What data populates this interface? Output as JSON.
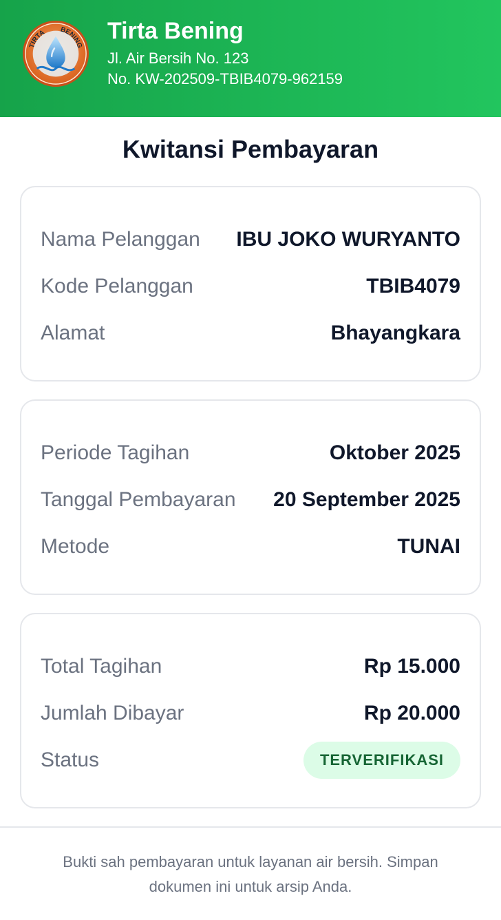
{
  "header": {
    "brand_name": "Tirta Bening",
    "address": "Jl. Air Bersih No. 123",
    "receipt_no": "No. KW-202509-TBIB4079-962159",
    "logo_text_left": "TIRTA",
    "logo_text_right": "BENING"
  },
  "title": "Kwitansi Pembayaran",
  "customer": {
    "name_label": "Nama Pelanggan",
    "name_value": "IBU JOKO WURYANTO",
    "code_label": "Kode Pelanggan",
    "code_value": "TBIB4079",
    "address_label": "Alamat",
    "address_value": "Bhayangkara"
  },
  "billing": {
    "period_label": "Periode Tagihan",
    "period_value": "Oktober 2025",
    "date_label": "Tanggal Pembayaran",
    "date_value": "20 September 2025",
    "method_label": "Metode",
    "method_value": "TUNAI"
  },
  "payment": {
    "total_label": "Total Tagihan",
    "total_value": "Rp 15.000",
    "paid_label": "Jumlah Dibayar",
    "paid_value": "Rp 20.000",
    "status_label": "Status",
    "status_value": "TERVERIFIKASI"
  },
  "footer": {
    "note": "Bukti sah pembayaran untuk layanan air bersih. Simpan dokumen ini untuk arsip Anda."
  },
  "colors": {
    "header_start": "#16a34a",
    "header_end": "#22c55e",
    "badge_bg": "#dcfce7",
    "badge_text": "#166534"
  }
}
